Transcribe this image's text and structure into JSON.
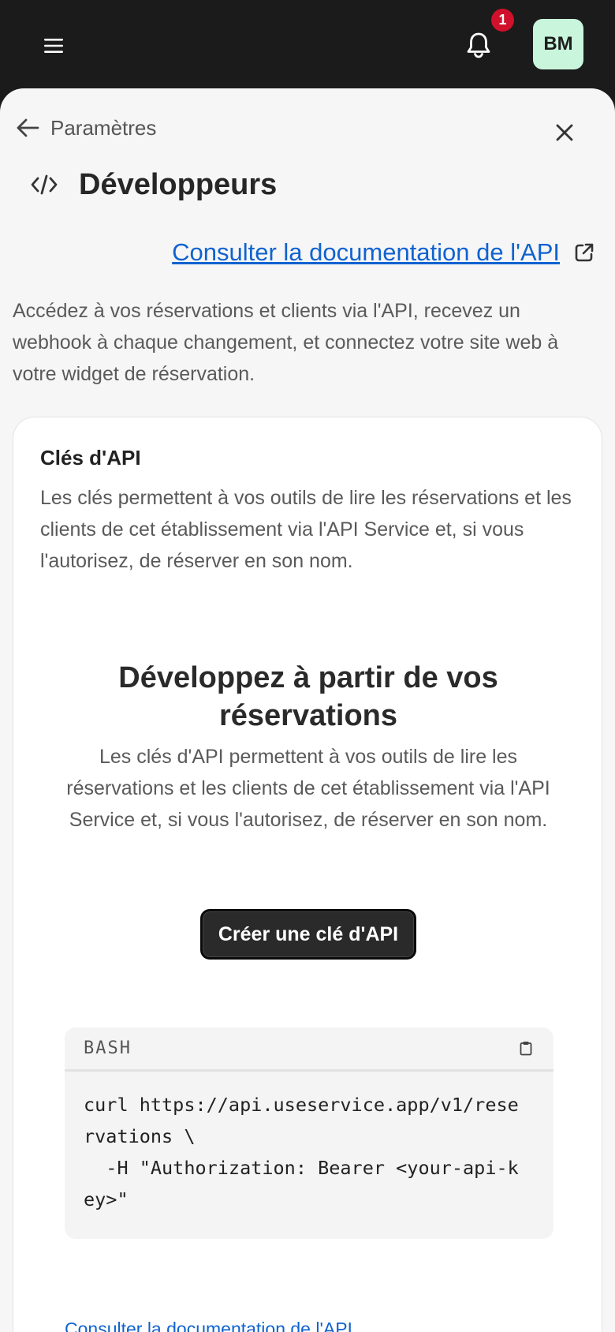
{
  "topbar": {
    "menu_icon": "hamburger-icon",
    "bell_icon": "bell-icon",
    "notification_count": "1",
    "avatar_initials": "BM",
    "avatar_color": "#c9f5dc"
  },
  "header": {
    "back_label": "Paramètres",
    "back_icon": "arrow-left-icon",
    "close_icon": "close-icon",
    "title_icon": "code-icon",
    "title": "Développeurs"
  },
  "docs_link": {
    "label": "Consulter la documentation de l'API",
    "icon": "external-link-icon"
  },
  "intro": "Accédez à vos réservations et clients via l'API, recevez un webhook à chaque changement, et connectez votre site web à votre widget de réservation.",
  "api_keys": {
    "title": "Clés d'API",
    "description": "Les clés permettent à vos outils de lire les réservations et les clients de cet établissement via l'API Service et, si vous l'autorisez, de réserver en son nom.",
    "empty_state": {
      "title": "Développez à partir de vos réservations",
      "description": "Les clés d'API permettent à vos outils de lire les réservations et les clients de cet établissement via l'API Service et, si vous l'autorisez, de réserver en son nom.",
      "create_button": "Créer une clé d'API"
    },
    "code": {
      "language": "BASH",
      "copy_icon": "clipboard-icon",
      "content": "curl https://api.useservice.app/v1/rese\nrvations \\\n  -H \"Authorization: Bearer <your-api-k\ney>\""
    },
    "docs_link_label": "Consulter la documentation de l'API"
  },
  "colors": {
    "topbar": "#1b1b1b",
    "sheet": "#f6f6f6",
    "link": "#1063cf",
    "badge": "#d0112b",
    "button": "#2a2a2a"
  }
}
